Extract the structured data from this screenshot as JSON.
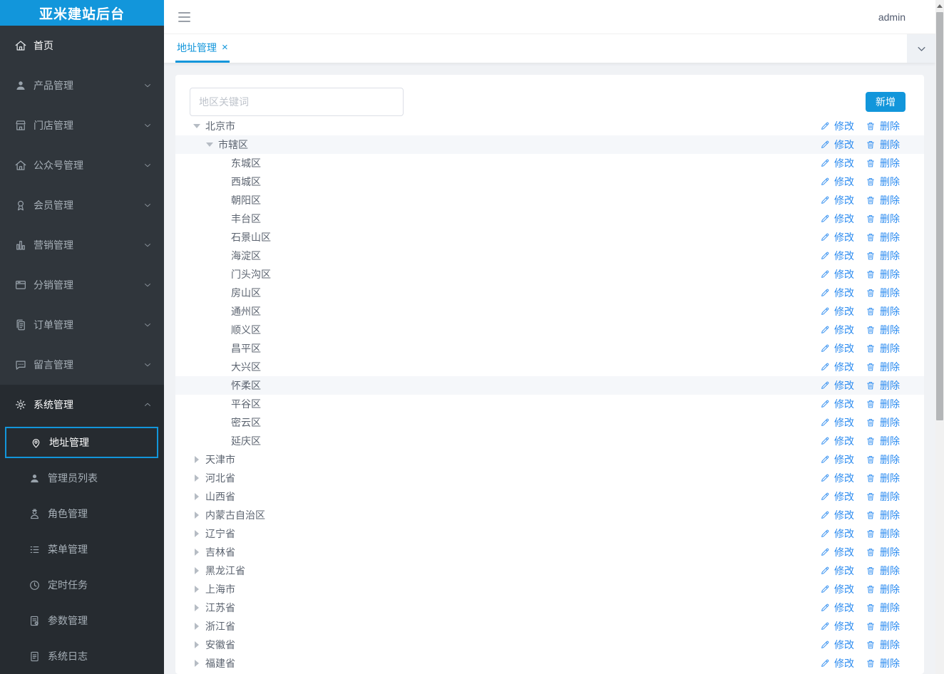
{
  "app": {
    "logo_title": "亚米建站后台",
    "username": "admin"
  },
  "colors": {
    "accent": "#1296db",
    "link": "#2d8cf0",
    "sidebar_bg": "#30363c",
    "sidebar_section_bg": "#262b30",
    "page_bg": "#f0f2f5"
  },
  "sidebar": {
    "items": [
      {
        "key": "home",
        "label": "首页",
        "icon": "home-icon",
        "expandable": false
      },
      {
        "key": "product",
        "label": "产品管理",
        "icon": "user-icon",
        "expandable": true
      },
      {
        "key": "store",
        "label": "门店管理",
        "icon": "store-icon",
        "expandable": true
      },
      {
        "key": "official-account",
        "label": "公众号管理",
        "icon": "house-icon",
        "expandable": true
      },
      {
        "key": "member",
        "label": "会员管理",
        "icon": "member-icon",
        "expandable": true
      },
      {
        "key": "marketing",
        "label": "营销管理",
        "icon": "bar-chart-icon",
        "expandable": true
      },
      {
        "key": "distribution",
        "label": "分销管理",
        "icon": "layout-icon",
        "expandable": true
      },
      {
        "key": "order",
        "label": "订单管理",
        "icon": "order-icon",
        "expandable": true
      },
      {
        "key": "message",
        "label": "留言管理",
        "icon": "message-icon",
        "expandable": true
      }
    ],
    "system": {
      "key": "system",
      "label": "系统管理",
      "icon": "gear-icon",
      "expanded": true,
      "children": [
        {
          "key": "address",
          "label": "地址管理",
          "icon": "location-pin-icon",
          "active": true
        },
        {
          "key": "admin-list",
          "label": "管理员列表",
          "icon": "user-icon"
        },
        {
          "key": "role",
          "label": "角色管理",
          "icon": "role-icon"
        },
        {
          "key": "menu",
          "label": "菜单管理",
          "icon": "list-icon"
        },
        {
          "key": "cron",
          "label": "定时任务",
          "icon": "clock-icon"
        },
        {
          "key": "param",
          "label": "参数管理",
          "icon": "doc-gear-icon"
        },
        {
          "key": "log",
          "label": "系统日志",
          "icon": "doc-icon"
        }
      ]
    }
  },
  "tabs": [
    {
      "label": "地址管理",
      "closable": true,
      "active": true
    }
  ],
  "toolbar": {
    "search_placeholder": "地区关键词",
    "add_label": "新增"
  },
  "row_actions": {
    "edit": "修改",
    "delete": "删除"
  },
  "tree": [
    {
      "label": "北京市",
      "level": 0,
      "state": "expanded"
    },
    {
      "label": "市辖区",
      "level": 1,
      "state": "expanded",
      "highlight": true
    },
    {
      "label": "东城区",
      "level": 2,
      "state": "leaf"
    },
    {
      "label": "西城区",
      "level": 2,
      "state": "leaf"
    },
    {
      "label": "朝阳区",
      "level": 2,
      "state": "leaf"
    },
    {
      "label": "丰台区",
      "level": 2,
      "state": "leaf"
    },
    {
      "label": "石景山区",
      "level": 2,
      "state": "leaf"
    },
    {
      "label": "海淀区",
      "level": 2,
      "state": "leaf"
    },
    {
      "label": "门头沟区",
      "level": 2,
      "state": "leaf"
    },
    {
      "label": "房山区",
      "level": 2,
      "state": "leaf"
    },
    {
      "label": "通州区",
      "level": 2,
      "state": "leaf"
    },
    {
      "label": "顺义区",
      "level": 2,
      "state": "leaf"
    },
    {
      "label": "昌平区",
      "level": 2,
      "state": "leaf"
    },
    {
      "label": "大兴区",
      "level": 2,
      "state": "leaf"
    },
    {
      "label": "怀柔区",
      "level": 2,
      "state": "leaf",
      "highlight": true
    },
    {
      "label": "平谷区",
      "level": 2,
      "state": "leaf"
    },
    {
      "label": "密云区",
      "level": 2,
      "state": "leaf"
    },
    {
      "label": "延庆区",
      "level": 2,
      "state": "leaf"
    },
    {
      "label": "天津市",
      "level": 0,
      "state": "collapsed"
    },
    {
      "label": "河北省",
      "level": 0,
      "state": "collapsed"
    },
    {
      "label": "山西省",
      "level": 0,
      "state": "collapsed"
    },
    {
      "label": "内蒙古自治区",
      "level": 0,
      "state": "collapsed"
    },
    {
      "label": "辽宁省",
      "level": 0,
      "state": "collapsed"
    },
    {
      "label": "吉林省",
      "level": 0,
      "state": "collapsed"
    },
    {
      "label": "黑龙江省",
      "level": 0,
      "state": "collapsed"
    },
    {
      "label": "上海市",
      "level": 0,
      "state": "collapsed"
    },
    {
      "label": "江苏省",
      "level": 0,
      "state": "collapsed"
    },
    {
      "label": "浙江省",
      "level": 0,
      "state": "collapsed"
    },
    {
      "label": "安徽省",
      "level": 0,
      "state": "collapsed"
    },
    {
      "label": "福建省",
      "level": 0,
      "state": "collapsed"
    }
  ]
}
